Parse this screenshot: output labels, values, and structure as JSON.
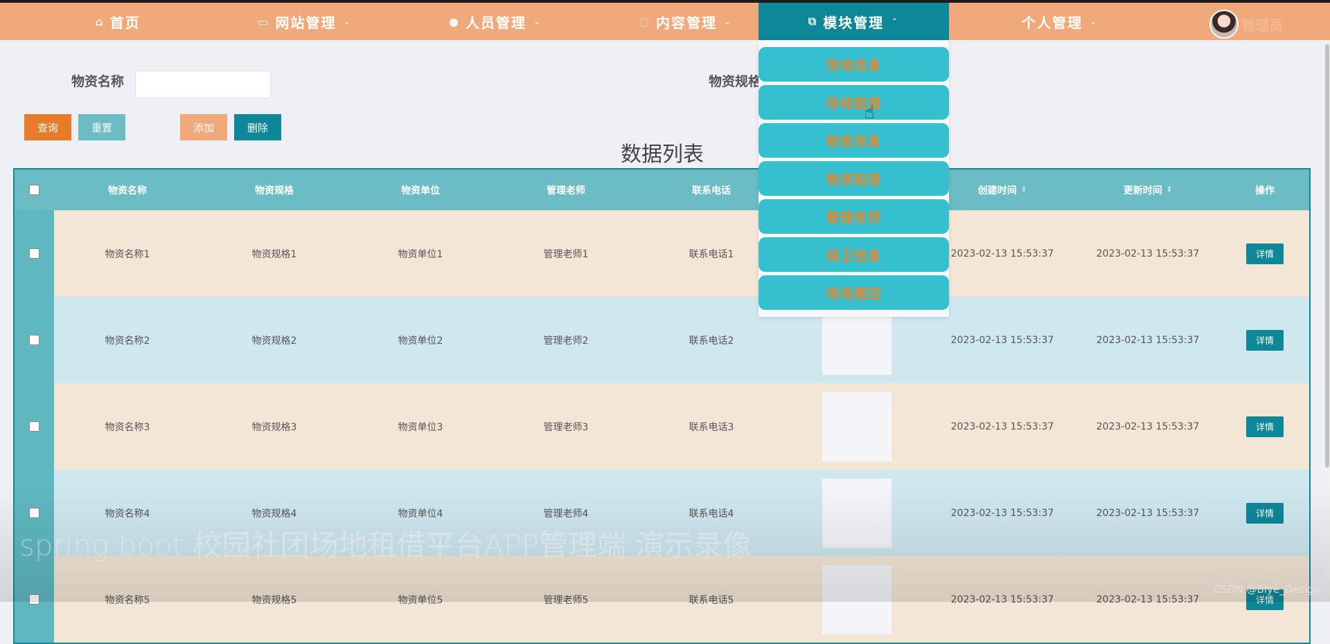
{
  "nav": {
    "items": [
      {
        "label": "首页",
        "icon": "home-icon",
        "glyph": "⌂",
        "chevron": ""
      },
      {
        "label": "网站管理",
        "icon": "monitor-icon",
        "glyph": "▭",
        "chevron": "⌄"
      },
      {
        "label": "人员管理",
        "icon": "user-icon",
        "glyph": "●",
        "chevron": "⌄"
      },
      {
        "label": "内容管理",
        "icon": "chat-icon",
        "glyph": "◌",
        "chevron": "⌄"
      },
      {
        "label": "模块管理",
        "icon": "copy-icon",
        "glyph": "⧉",
        "chevron": "⌃"
      },
      {
        "label": "个人管理",
        "icon": "",
        "glyph": "",
        "chevron": "⌄"
      }
    ],
    "username": "管理员"
  },
  "search": {
    "name_label": "物资名称",
    "name_value": "",
    "spec_label": "物资规格"
  },
  "buttons": {
    "query": "查询",
    "reset": "重置",
    "add": "添加",
    "delete": "删除"
  },
  "table": {
    "title": "数据列表",
    "columns": [
      "物资名称",
      "物资规格",
      "物资单位",
      "管理老师",
      "联系电话",
      "",
      "创建时间",
      "更新时间",
      "操作"
    ],
    "detail_label": "详情",
    "rows": [
      {
        "name": "物资名称1",
        "spec": "物资规格1",
        "unit": "物资单位1",
        "teacher": "管理老师1",
        "phone": "联系电话1",
        "created": "2023-02-13 15:53:37",
        "updated": "2023-02-13 15:53:37"
      },
      {
        "name": "物资名称2",
        "spec": "物资规格2",
        "unit": "物资单位2",
        "teacher": "管理老师2",
        "phone": "联系电话2",
        "created": "2023-02-13 15:53:37",
        "updated": "2023-02-13 15:53:37"
      },
      {
        "name": "物资名称3",
        "spec": "物资规格3",
        "unit": "物资单位3",
        "teacher": "管理老师3",
        "phone": "联系电话3",
        "created": "2023-02-13 15:53:37",
        "updated": "2023-02-13 15:53:37"
      },
      {
        "name": "物资名称4",
        "spec": "物资规格4",
        "unit": "物资单位4",
        "teacher": "管理老师4",
        "phone": "联系电话4",
        "created": "2023-02-13 15:53:37",
        "updated": "2023-02-13 15:53:37"
      },
      {
        "name": "物资名称5",
        "spec": "物资规格5",
        "unit": "物资单位5",
        "teacher": "管理老师5",
        "phone": "联系电话5",
        "created": "2023-02-13 15:53:37",
        "updated": "2023-02-13 15:53:37"
      }
    ]
  },
  "dropdown": {
    "items": [
      "场地信息",
      "场地租借",
      "物资信息",
      "物资租借",
      "管理老师",
      "保卫信息",
      "场地撤回"
    ]
  },
  "overlay": {
    "watermark": "spring boot 校园社团场地租借平台APP管理端 演示录像",
    "csdn": "CSDN @Biye_Design"
  },
  "colors": {
    "nav_bg": "#f0a97a",
    "nav_active": "#0e8799",
    "query_btn": "#e87b2a",
    "reset_btn": "#6bbcc4",
    "add_btn": "#f0a97a",
    "delete_btn": "#0e8799",
    "header_bg": "#6bbcc4",
    "row_odd": "#f3e6d6",
    "row_even": "#cfe7ef",
    "dropdown_item": "#36bfcf",
    "dropdown_text": "#e08a34"
  }
}
